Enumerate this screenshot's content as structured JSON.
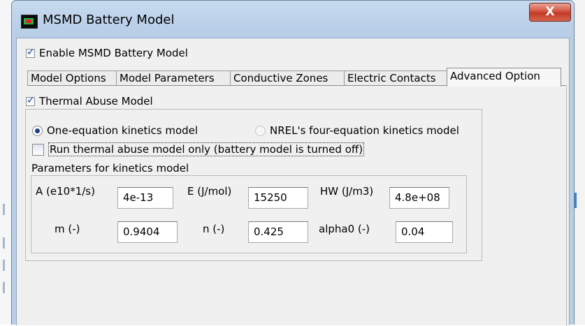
{
  "window": {
    "title": "MSMD Battery Model",
    "close_label": "X"
  },
  "enable_checkbox": {
    "label": "Enable MSMD Battery Model",
    "checked": true
  },
  "tabs": [
    {
      "label": "Model Options",
      "active": false
    },
    {
      "label": "Model Parameters",
      "active": false
    },
    {
      "label": "Conductive Zones",
      "active": false
    },
    {
      "label": "Electric Contacts",
      "active": false
    },
    {
      "label": "Advanced Option",
      "active": true
    }
  ],
  "thermal_abuse": {
    "label": "Thermal Abuse Model",
    "checked": true,
    "radio_one_equation": "One-equation kinetics model",
    "radio_four_equation": "NREL's four-equation kinetics model",
    "run_only_label": "Run thermal abuse model only (battery model is turned off)",
    "run_only_checked": false,
    "params_caption": "Parameters for kinetics model",
    "params": {
      "A": {
        "label": "A (e10*1/s)",
        "value": "4e-13"
      },
      "E": {
        "label": "E (J/mol)",
        "value": "15250"
      },
      "HW": {
        "label": "HW (J/m3)",
        "value": "4.8e+08"
      },
      "m": {
        "label": "m (-)",
        "value": "0.9404"
      },
      "n": {
        "label": "n (-)",
        "value": "0.425"
      },
      "alpha0": {
        "label": "alpha0 (-)",
        "value": "0.04"
      }
    }
  },
  "colors": {
    "title_bar": "#b9cfe8",
    "close_button": "#c94a34",
    "dialog_bg": "#f0f0f0",
    "radio_dot": "#1f3f8d"
  }
}
